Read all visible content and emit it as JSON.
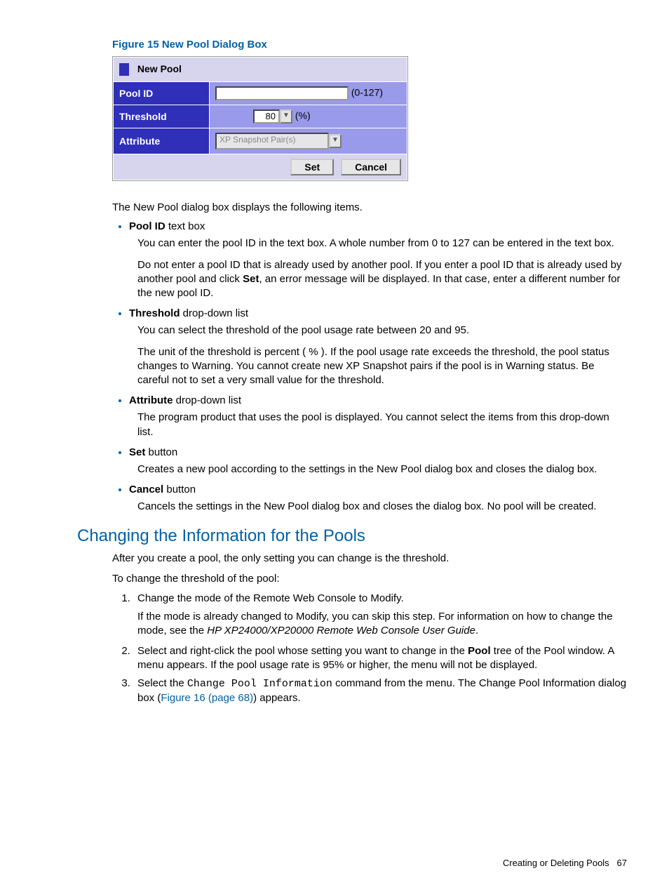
{
  "figure": {
    "caption": "Figure 15 New Pool Dialog Box",
    "title": "New Pool",
    "rows": {
      "poolid": {
        "label": "Pool ID",
        "range": "(0-127)"
      },
      "threshold": {
        "label": "Threshold",
        "value": "80",
        "unit": "(%)"
      },
      "attribute": {
        "label": "Attribute",
        "value": "XP Snapshot Pair(s)"
      }
    },
    "buttons": {
      "set": "Set",
      "cancel": "Cancel"
    }
  },
  "intro": "The New Pool dialog box displays the following items.",
  "items": [
    {
      "term": "Pool ID",
      "after": " text box",
      "paras": [
        "You can enter the pool ID in the text box. A whole number from 0 to 127 can be entered in the text box.",
        [
          "Do not enter a pool ID that is already used by another pool. If you enter a pool ID that is already used by another pool and click ",
          {
            "b": "Set"
          },
          ", an error message will be displayed. In that case, enter a different number for the new pool ID."
        ]
      ]
    },
    {
      "term": "Threshold",
      "after": " drop-down list",
      "paras": [
        "You can select the threshold of the pool usage rate between 20 and 95.",
        "The unit of the threshold is percent ( % ). If the pool usage rate exceeds the threshold, the pool status changes to Warning. You cannot create new XP Snapshot pairs if the pool is in Warning status. Be careful not to set a very small value for the threshold."
      ]
    },
    {
      "term": "Attribute",
      "after": " drop-down list",
      "paras": [
        "The program product that uses the pool is displayed. You cannot select the items from this drop-down list."
      ]
    },
    {
      "term": "Set",
      "after": " button",
      "paras": [
        "Creates a new pool according to the settings in the New Pool dialog box and closes the dialog box."
      ]
    },
    {
      "term": "Cancel",
      "after": " button",
      "paras": [
        "Cancels the settings in the New Pool dialog box and closes the dialog box. No pool will be created."
      ]
    }
  ],
  "section": {
    "title": "Changing the Information for the Pools",
    "p1": "After you create a pool, the only setting you can change is the threshold.",
    "p2": "To change the threshold of the pool:",
    "steps": [
      {
        "main": "Change the mode of the Remote Web Console to Modify.",
        "sub": [
          "If the mode is already changed to Modify, you can skip this step. For information on how to change the mode, see the ",
          {
            "i": "HP XP24000/XP20000 Remote Web Console User Guide"
          },
          "."
        ]
      },
      {
        "main": [
          "Select and right-click the pool whose setting you want to change in the ",
          {
            "b": "Pool"
          },
          " tree of the Pool window. A menu appears. If the pool usage rate is 95% or higher, the menu will not be displayed."
        ]
      },
      {
        "main": [
          "Select the ",
          {
            "c": "Change Pool Information"
          },
          " command from the menu. The Change Pool Information dialog box (",
          {
            "l": "Figure 16 (page 68)"
          },
          ") appears."
        ]
      }
    ]
  },
  "footer": {
    "label": "Creating or Deleting Pools",
    "page": "67"
  }
}
